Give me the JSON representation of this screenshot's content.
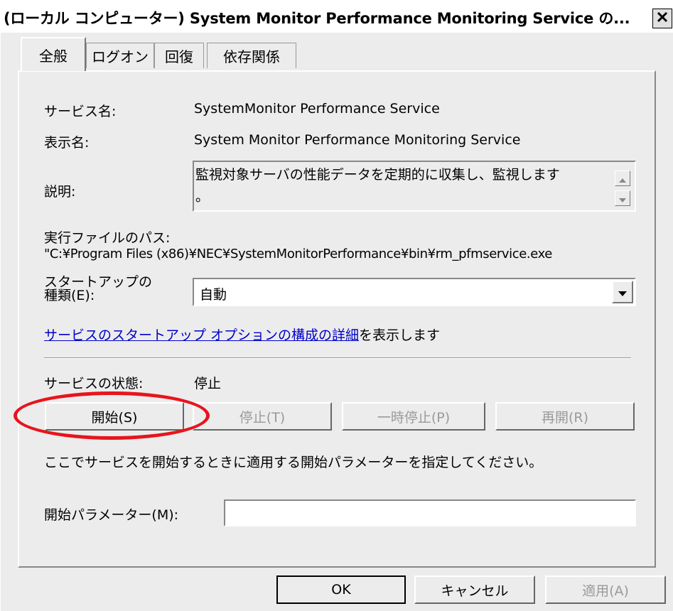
{
  "window": {
    "title": "(ローカル コンピューター) System Monitor Performance Monitoring Service の...",
    "close_glyph": "✕"
  },
  "tabs": [
    {
      "label": "全般",
      "active": true
    },
    {
      "label": "ログオン",
      "active": false
    },
    {
      "label": "回復",
      "active": false
    },
    {
      "label": "依存関係",
      "active": false
    }
  ],
  "general": {
    "service_name_label": "サービス名:",
    "service_name_value": "SystemMonitor Performance Service",
    "display_name_label": "表示名:",
    "display_name_value": "System Monitor Performance Monitoring Service",
    "description_label": "説明:",
    "description_line1": "監視対象サーバの性能データを定期的に収集し、監視します",
    "description_line2": "。",
    "exe_path_label": "実行ファイルのパス:",
    "exe_path_value": "\"C:¥Program Files (x86)¥NEC¥SystemMonitorPerformance¥bin¥rm_pfmservice.exe",
    "startup_type_label_line1": "スタートアップの",
    "startup_type_label_line2": "種類(E):",
    "startup_type_value": "自動",
    "startup_link_text": "サービスのスタートアップ オプションの構成の詳細",
    "startup_link_suffix": "を表示します",
    "status_label": "サービスの状態:",
    "status_value": "停止",
    "hint_text": "ここでサービスを開始するときに適用する開始パラメーターを指定してください。",
    "start_params_label": "開始パラメーター(M):",
    "start_params_value": ""
  },
  "service_buttons": {
    "start": "開始(S)",
    "stop": "停止(T)",
    "pause": "一時停止(P)",
    "resume": "再開(R)"
  },
  "dialog_buttons": {
    "ok": "OK",
    "cancel": "キャンセル",
    "apply": "適用(A)"
  },
  "colors": {
    "highlight": "#e8141c",
    "link": "#0000cc",
    "disabled_text": "#9a9a9a"
  }
}
